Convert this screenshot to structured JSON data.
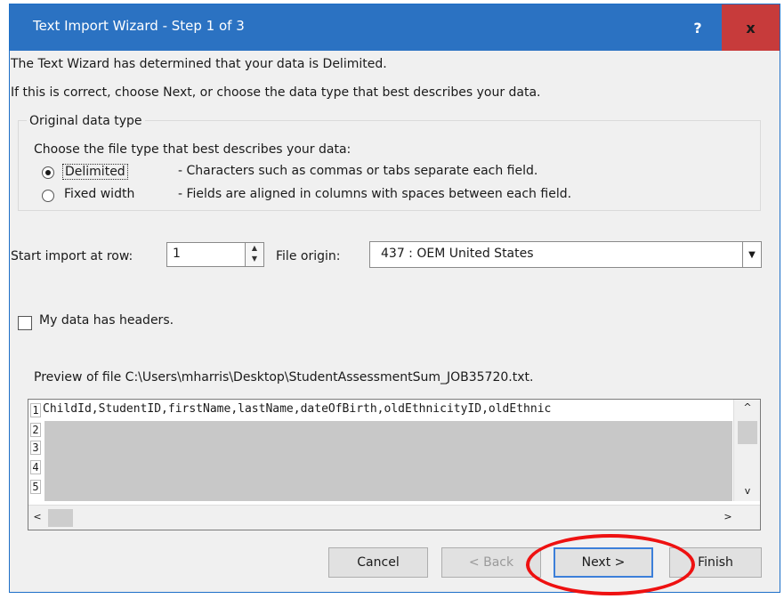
{
  "window": {
    "title": "Text Import Wizard - Step 1 of 3",
    "help": "?",
    "close": "x"
  },
  "intro": {
    "line1": "The Text Wizard has determined that your data is Delimited.",
    "line2": "If this is correct, choose Next, or choose the data type that best describes your data."
  },
  "data_type": {
    "legend": "Original data type",
    "prompt": "Choose the file type that best describes your data:",
    "delimited_label": "Delimited",
    "delimited_desc": "- Characters such as commas or tabs separate each field.",
    "fixed_label": "Fixed width",
    "fixed_desc": "- Fields are aligned in columns with spaces between each field.",
    "selected": "Delimited"
  },
  "start_row": {
    "label": "Start import at row:",
    "value": "1"
  },
  "file_origin": {
    "label": "File origin:",
    "value": "437 : OEM United States"
  },
  "headers": {
    "label": "My data has headers.",
    "checked": false
  },
  "preview": {
    "label": "Preview of file C:\\Users\\mharris\\Desktop\\StudentAssessmentSum_JOB35720.txt.",
    "rows": [
      "1",
      "2",
      "3",
      "4",
      "5"
    ],
    "line1": "ChildId,StudentID,firstName,lastName,dateOfBirth,oldEthnicityID,oldEthnic"
  },
  "buttons": {
    "cancel": "Cancel",
    "back": "< Back",
    "next": "Next >",
    "finish": "Finish"
  },
  "colors": {
    "titlebar": "#2b72c2",
    "close": "#c73b3b",
    "highlight": "#e11111"
  }
}
